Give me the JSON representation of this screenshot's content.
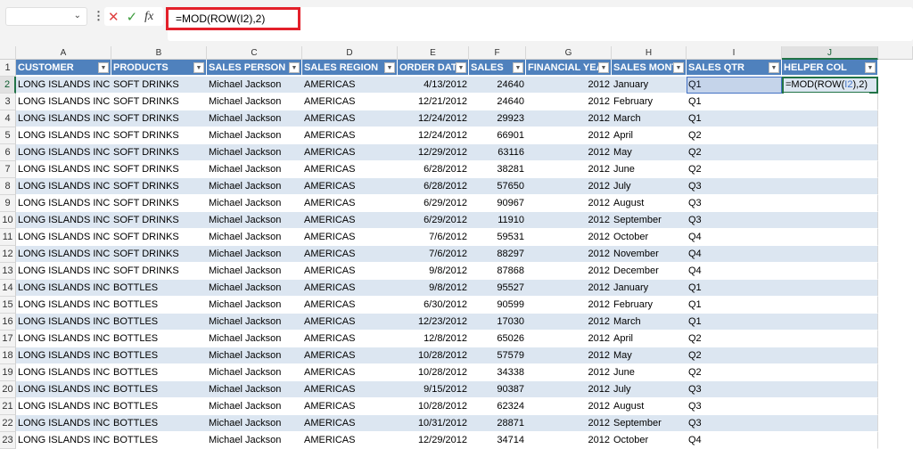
{
  "formula_bar": {
    "name_box": "",
    "cancel_icon": "close-icon",
    "enter_icon": "check-icon",
    "fx_label": "fx",
    "formula": "=MOD(ROW(I2),2)"
  },
  "columns": [
    "A",
    "B",
    "C",
    "D",
    "E",
    "F",
    "G",
    "H",
    "I",
    "J"
  ],
  "headers": [
    "CUSTOMER",
    "PRODUCTS",
    "SALES PERSON",
    "SALES REGION",
    "ORDER DATE",
    "SALES",
    "FINANCIAL YEA",
    "SALES MONT",
    "SALES QTR",
    "HELPER COL"
  ],
  "active_cell": {
    "ref": "J2",
    "edit_parts": [
      "=MOD(ROW(",
      "I2",
      "),2)"
    ]
  },
  "colors": {
    "header_fill": "#4f81bd",
    "band_fill": "#dce6f1",
    "highlight_border": "#e3202a",
    "active_border": "#217346"
  },
  "rows": [
    [
      "LONG ISLANDS INC",
      "SOFT DRINKS",
      "Michael Jackson",
      "AMERICAS",
      "4/13/2012",
      "24640",
      "2012",
      "January",
      "Q1"
    ],
    [
      "LONG ISLANDS INC",
      "SOFT DRINKS",
      "Michael Jackson",
      "AMERICAS",
      "12/21/2012",
      "24640",
      "2012",
      "February",
      "Q1"
    ],
    [
      "LONG ISLANDS INC",
      "SOFT DRINKS",
      "Michael Jackson",
      "AMERICAS",
      "12/24/2012",
      "29923",
      "2012",
      "March",
      "Q1"
    ],
    [
      "LONG ISLANDS INC",
      "SOFT DRINKS",
      "Michael Jackson",
      "AMERICAS",
      "12/24/2012",
      "66901",
      "2012",
      "April",
      "Q2"
    ],
    [
      "LONG ISLANDS INC",
      "SOFT DRINKS",
      "Michael Jackson",
      "AMERICAS",
      "12/29/2012",
      "63116",
      "2012",
      "May",
      "Q2"
    ],
    [
      "LONG ISLANDS INC",
      "SOFT DRINKS",
      "Michael Jackson",
      "AMERICAS",
      "6/28/2012",
      "38281",
      "2012",
      "June",
      "Q2"
    ],
    [
      "LONG ISLANDS INC",
      "SOFT DRINKS",
      "Michael Jackson",
      "AMERICAS",
      "6/28/2012",
      "57650",
      "2012",
      "July",
      "Q3"
    ],
    [
      "LONG ISLANDS INC",
      "SOFT DRINKS",
      "Michael Jackson",
      "AMERICAS",
      "6/29/2012",
      "90967",
      "2012",
      "August",
      "Q3"
    ],
    [
      "LONG ISLANDS INC",
      "SOFT DRINKS",
      "Michael Jackson",
      "AMERICAS",
      "6/29/2012",
      "11910",
      "2012",
      "September",
      "Q3"
    ],
    [
      "LONG ISLANDS INC",
      "SOFT DRINKS",
      "Michael Jackson",
      "AMERICAS",
      "7/6/2012",
      "59531",
      "2012",
      "October",
      "Q4"
    ],
    [
      "LONG ISLANDS INC",
      "SOFT DRINKS",
      "Michael Jackson",
      "AMERICAS",
      "7/6/2012",
      "88297",
      "2012",
      "November",
      "Q4"
    ],
    [
      "LONG ISLANDS INC",
      "SOFT DRINKS",
      "Michael Jackson",
      "AMERICAS",
      "9/8/2012",
      "87868",
      "2012",
      "December",
      "Q4"
    ],
    [
      "LONG ISLANDS INC",
      "BOTTLES",
      "Michael Jackson",
      "AMERICAS",
      "9/8/2012",
      "95527",
      "2012",
      "January",
      "Q1"
    ],
    [
      "LONG ISLANDS INC",
      "BOTTLES",
      "Michael Jackson",
      "AMERICAS",
      "6/30/2012",
      "90599",
      "2012",
      "February",
      "Q1"
    ],
    [
      "LONG ISLANDS INC",
      "BOTTLES",
      "Michael Jackson",
      "AMERICAS",
      "12/23/2012",
      "17030",
      "2012",
      "March",
      "Q1"
    ],
    [
      "LONG ISLANDS INC",
      "BOTTLES",
      "Michael Jackson",
      "AMERICAS",
      "12/8/2012",
      "65026",
      "2012",
      "April",
      "Q2"
    ],
    [
      "LONG ISLANDS INC",
      "BOTTLES",
      "Michael Jackson",
      "AMERICAS",
      "10/28/2012",
      "57579",
      "2012",
      "May",
      "Q2"
    ],
    [
      "LONG ISLANDS INC",
      "BOTTLES",
      "Michael Jackson",
      "AMERICAS",
      "10/28/2012",
      "34338",
      "2012",
      "June",
      "Q2"
    ],
    [
      "LONG ISLANDS INC",
      "BOTTLES",
      "Michael Jackson",
      "AMERICAS",
      "9/15/2012",
      "90387",
      "2012",
      "July",
      "Q3"
    ],
    [
      "LONG ISLANDS INC",
      "BOTTLES",
      "Michael Jackson",
      "AMERICAS",
      "10/28/2012",
      "62324",
      "2012",
      "August",
      "Q3"
    ],
    [
      "LONG ISLANDS INC",
      "BOTTLES",
      "Michael Jackson",
      "AMERICAS",
      "10/31/2012",
      "28871",
      "2012",
      "September",
      "Q3"
    ],
    [
      "LONG ISLANDS INC",
      "BOTTLES",
      "Michael Jackson",
      "AMERICAS",
      "12/29/2012",
      "34714",
      "2012",
      "October",
      "Q4"
    ]
  ]
}
